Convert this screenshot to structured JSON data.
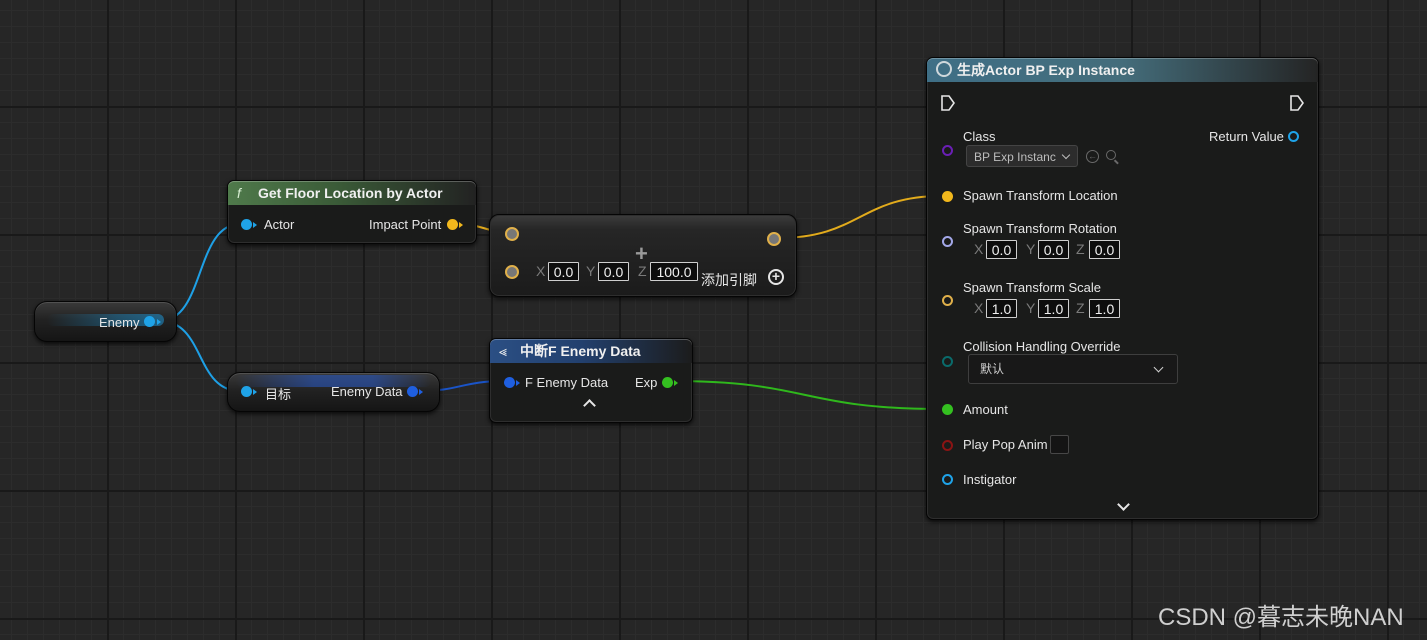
{
  "enemy_variable": {
    "label": "Enemy"
  },
  "get_floor_node": {
    "icon": "f",
    "title": "Get Floor Location by Actor",
    "input_label": "Actor",
    "output_label": "Impact Point"
  },
  "add_node": {
    "x_axis": "X",
    "x_value": "0.0",
    "y_axis": "Y",
    "y_value": "0.0",
    "z_axis": "Z",
    "z_value": "100.0",
    "add_pin_label": "添加引脚"
  },
  "get_enemy_data_node": {
    "target_label": "目标",
    "output_label": "Enemy Data"
  },
  "break_node": {
    "title": "中断F Enemy Data",
    "input_label": "F Enemy Data",
    "output_label": "Exp"
  },
  "spawn_node": {
    "title": "生成Actor BP Exp Instance",
    "class_label": "Class",
    "class_value": "BP Exp Instanc",
    "return_value_label": "Return Value",
    "location_label": "Spawn Transform Location",
    "rotation_label": "Spawn Transform Rotation",
    "rotation": {
      "x_axis": "X",
      "x": "0.0",
      "y_axis": "Y",
      "y": "0.0",
      "z_axis": "Z",
      "z": "0.0"
    },
    "scale_label": "Spawn Transform Scale",
    "scale": {
      "x_axis": "X",
      "x": "1.0",
      "y_axis": "Y",
      "y": "1.0",
      "z_axis": "Z",
      "z": "1.0"
    },
    "collision_label": "Collision Handling Override",
    "collision_value": "默认",
    "amount_label": "Amount",
    "play_pop_anim_label": "Play Pop Anim",
    "instigator_label": "Instigator"
  },
  "watermark": "CSDN @暮志未晚NAN",
  "colors": {
    "object_pin": "#1fa3e8",
    "struct_pin": "#1f5fe0",
    "vector_pin": "#f2b81c",
    "int_pin": "#34c020",
    "class_pin": "#6a1fb5",
    "rotator_pin": "#a3a8e8",
    "enum_pin": "#0a6b6b",
    "bool_pin": "#8a1414"
  }
}
